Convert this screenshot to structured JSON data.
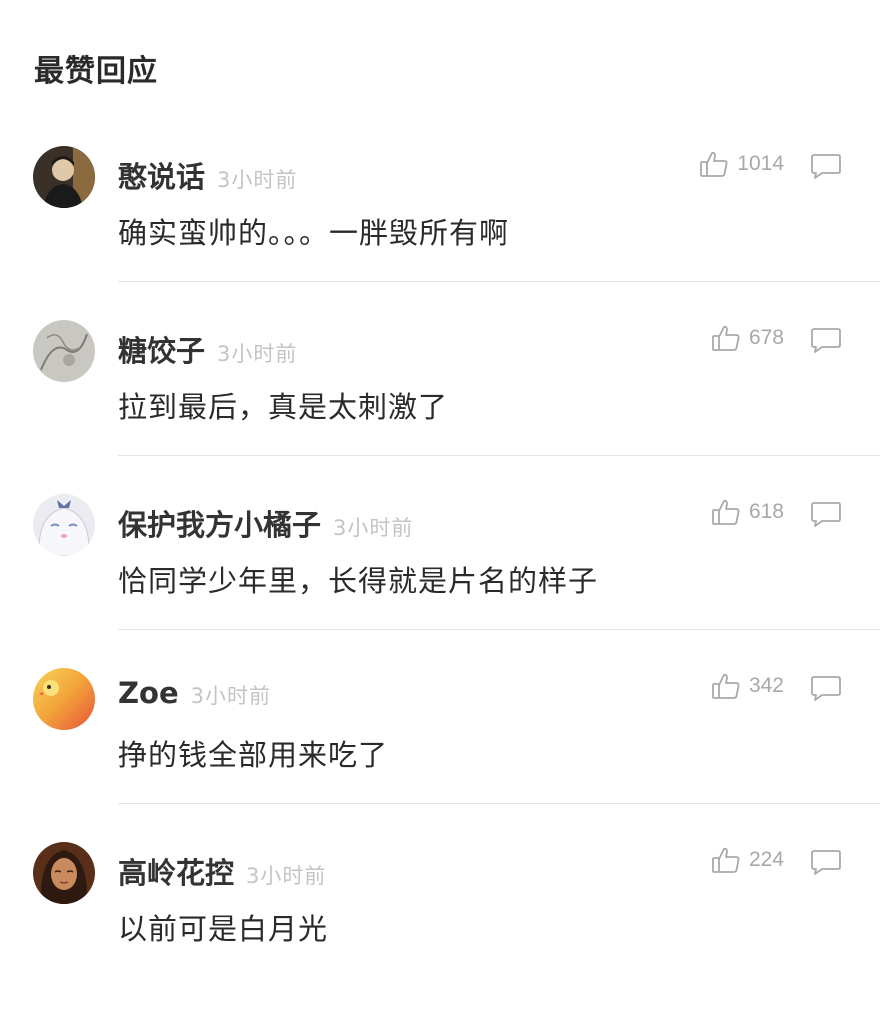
{
  "section_title": "最赞回应",
  "comments": [
    {
      "username": "憨说话",
      "time": "3小时前",
      "likes": "1014",
      "text": "确实蛮帅的。。。一胖毁所有啊",
      "avatar_colors": [
        "#3b3027",
        "#e0c9a8",
        "#1a1a1a"
      ]
    },
    {
      "username": "糖饺子",
      "time": "3小时前",
      "likes": "678",
      "text": "拉到最后，真是太刺激了",
      "avatar_colors": [
        "#b9b7b2",
        "#8d8a84",
        "#d8d6d1"
      ]
    },
    {
      "username": "保护我方小橘子",
      "time": "3小时前",
      "likes": "618",
      "text": "恰同学少年里，长得就是片名的样子",
      "avatar_colors": [
        "#e9e6ef",
        "#7a8fb8",
        "#f7f7fb"
      ]
    },
    {
      "username": "Zoe",
      "time": "3小时前",
      "likes": "342",
      "text": "挣的钱全部用来吃了",
      "avatar_colors": [
        "#f2a33a",
        "#e8513a",
        "#f7d45a"
      ]
    },
    {
      "username": "高岭花控",
      "time": "3小时前",
      "likes": "224",
      "text": "以前可是白月光",
      "avatar_colors": [
        "#6b3a22",
        "#c98a5d",
        "#2e1a10"
      ]
    }
  ],
  "colors": {
    "like_icon": "#a9a9a9",
    "reply_icon": "#a9a9a9",
    "divider": "#e6e6e6",
    "time_text": "#c4c4c4"
  },
  "icons": {
    "like": "thumbs-up-icon",
    "reply": "speech-bubble-icon"
  }
}
